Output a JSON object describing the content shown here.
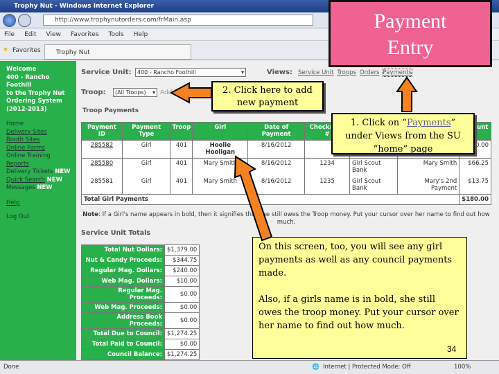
{
  "window": {
    "title": "Trophy Nut - Windows Internet Explorer",
    "url": "http://www.trophynutorders.com/frMain.asp"
  },
  "menu": [
    "File",
    "Edit",
    "View",
    "Favorites",
    "Tools",
    "Help"
  ],
  "favorites": {
    "label": "Favorites",
    "tab": "Trophy Nut"
  },
  "sidebar": {
    "welcome": [
      "Welcome",
      "400 - Rancho",
      "Foothill",
      "to the Trophy Nut",
      "Ordering System",
      "(2012-2013)"
    ],
    "links": [
      "Home",
      "Delivery Sites",
      "Booth Sites",
      "Online Forms",
      "Online Training",
      "Reports",
      "Delivery Tickets",
      "Quick Search",
      "Messages",
      "Help",
      "Log Out"
    ],
    "new_badge": "NEW"
  },
  "service_unit": {
    "label": "Service Unit:",
    "value": "400 - Rancho Foothill"
  },
  "views": {
    "label": "Views:",
    "items": [
      "Service Unit",
      "Troops",
      "Orders",
      "Payments"
    ]
  },
  "troop": {
    "label": "Troop:",
    "value": "(All Troops)",
    "add": "Add"
  },
  "troop_payments": {
    "title": "Troop Payments",
    "headers": [
      "Payment ID",
      "Payment Type",
      "Troop",
      "Girl",
      "Date of Payment",
      "Check/Dep #",
      "",
      "",
      "Amount"
    ],
    "rows": [
      [
        "285582",
        "Girl",
        "401",
        "Hoolie Hooligan",
        "8/16/2012",
        "",
        "",
        "",
        "$100.00"
      ],
      [
        "285580",
        "Girl",
        "401",
        "Mary Smith",
        "8/16/2012",
        "1234",
        "Girl Scout Bank",
        "Mary Smith",
        "$66.25"
      ],
      [
        "285581",
        "Girl",
        "401",
        "Mary Smith",
        "8/16/2012",
        "1235",
        "Girl Scout Bank",
        "Mary's 2nd Payment",
        "$13.75"
      ]
    ],
    "total_label": "Total Girl Payments",
    "total": "$180.00"
  },
  "note": {
    "label": "Note",
    "text": ": If a Girl's name appears in bold, then it signifies that she still owes the Troop money. Put your cursor over her name to find out how much."
  },
  "su_totals": {
    "title": "Service Unit Totals",
    "rows": [
      [
        "Total Nut Dollars:",
        "$1,379.00"
      ],
      [
        "Nut & Candy Proceeds:",
        "$344.75"
      ],
      [
        "Regular Mag. Dollars:",
        "$240.00"
      ],
      [
        "Web Mag. Dollars:",
        "$10.00"
      ],
      [
        "Regular Mag. Proceeds:",
        "$0.00"
      ],
      [
        "Web Mag. Proceeds:",
        "$0.00"
      ],
      [
        "Address Book Proceeds:",
        "$0.00"
      ],
      [
        "Total Due to Council:",
        "$1,274.25"
      ],
      [
        "Total Paid to Council:",
        "$0.00"
      ],
      [
        "Council Balance:",
        "$1,274.25"
      ]
    ]
  },
  "status": {
    "left": "Done",
    "zone": "Internet | Protected Mode: Off",
    "zoom": "100%"
  },
  "slide": {
    "title": "Payment Entry",
    "callout2": "2. Click here to add new payment",
    "callout1_pre": "1.   Click on “",
    "callout1_link": "Payments",
    "callout1_post": "” under Views from the SU “home” page",
    "callout3a": "On this screen, too, you will see any girl payments as well as any council payments made.",
    "callout3b": "Also, if a girls name is in bold, she still owes the troop money.  Put your cursor over her name to find out how much.",
    "page_number": "34"
  },
  "colors": {
    "sidebar_green": "#28b04a",
    "title_pink": "#f06292",
    "callout_yellow": "#ffff99",
    "arrow_orange": "#f58220"
  }
}
